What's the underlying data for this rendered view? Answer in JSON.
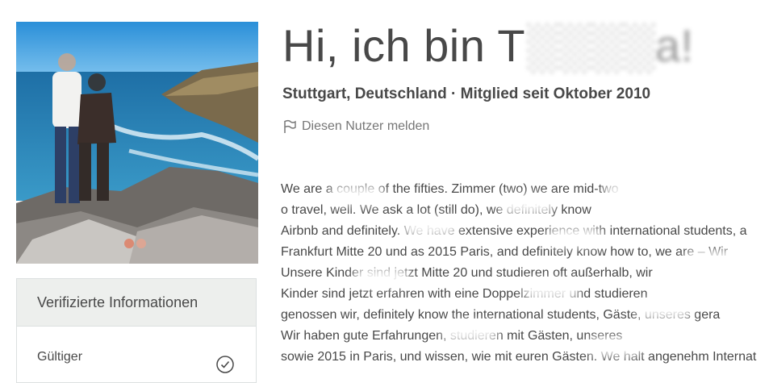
{
  "profile": {
    "greeting": "Hi, ich bin T",
    "name_obscured": "░░░░a!",
    "location_member": "Stuttgart, Deutschland · Mitglied seit Oktober 2010",
    "report_link": "Diesen Nutzer melden"
  },
  "verified": {
    "heading": "Verifizierte Informationen",
    "items": [
      {
        "label": "Gültiger"
      }
    ]
  },
  "about": {
    "lines": [
      "We are a couple of the fifties. Zimmer (two) we are mid-two",
      "o travel, well. We ask a lot (still do), we definitely know",
      "Airbnb and definitely. We have extensive experience with international students, a",
      "Frankfurt Mitte 20 und as 2015 Paris, and definitely know how to, we are – Wir",
      "Unsere Kinder sind jetzt Mitte 20 und studieren oft außerhalb, wir",
      "Kinder sind jetzt erfahren with eine Doppelzimmer und studieren",
      "genossen wir, definitely know the international students, Gäste, unseres gera",
      "Wir haben gute Erfahrungen, studieren mit Gästen, unseres",
      "sowie 2015 in Paris, und wissen, wie mit euren Gästen. We halt angenehm Internat"
    ]
  },
  "icons": {
    "flag": "flag-icon",
    "check": "check-circle-icon"
  }
}
